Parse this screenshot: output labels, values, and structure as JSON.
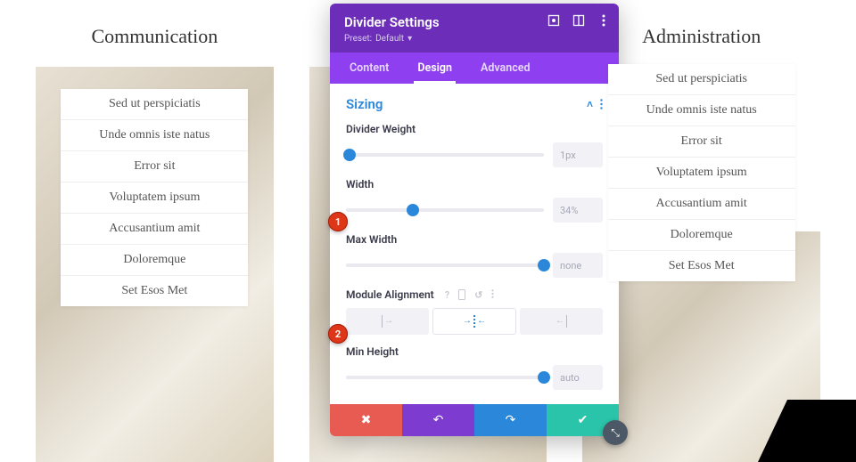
{
  "columns": [
    {
      "title": "Communication",
      "items": [
        "Sed ut perspiciatis",
        "Unde omnis iste natus",
        "Error sit",
        "Voluptatem ipsum",
        "Accusantium amit",
        "Doloremque",
        "Set Esos Met"
      ]
    },
    {
      "title": "",
      "items": []
    },
    {
      "title": "Administration",
      "items": [
        "Sed ut perspiciatis",
        "Unde omnis iste natus",
        "Error sit",
        "Voluptatem ipsum",
        "Accusantium amit",
        "Doloremque",
        "Set Esos Met"
      ]
    }
  ],
  "modal": {
    "title": "Divider Settings",
    "preset_label": "Preset:",
    "preset_value": "Default",
    "tabs": [
      "Content",
      "Design",
      "Advanced"
    ],
    "active_tab": 1,
    "section": "Sizing",
    "fields": {
      "divider_weight": {
        "label": "Divider Weight",
        "value": "1px",
        "pos": 2
      },
      "width": {
        "label": "Width",
        "value": "34%",
        "pos": 34
      },
      "max_width": {
        "label": "Max Width",
        "value": "none",
        "pos": 100
      },
      "alignment": {
        "label": "Module Alignment",
        "options": [
          "left",
          "center",
          "right"
        ],
        "selected": 1
      },
      "min_height": {
        "label": "Min Height",
        "value": "auto",
        "pos": 100
      }
    },
    "callouts": {
      "1": "1",
      "2": "2"
    }
  }
}
